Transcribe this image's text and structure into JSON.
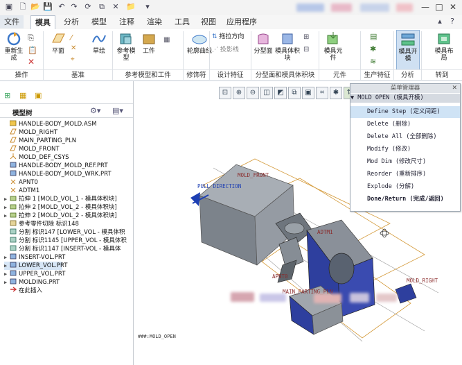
{
  "tabs": [
    {
      "label": "文件",
      "active": false
    },
    {
      "label": "模具",
      "active": true
    },
    {
      "label": "分析",
      "active": false
    },
    {
      "label": "模型",
      "active": false
    },
    {
      "label": "注释",
      "active": false
    },
    {
      "label": "渲染",
      "active": false
    },
    {
      "label": "工具",
      "active": false
    },
    {
      "label": "视图",
      "active": false
    },
    {
      "label": "应用程序",
      "active": false
    }
  ],
  "ribbon": {
    "regenerate": "重新生成",
    "plane": "平面",
    "sketch": "草绘",
    "ref_model": "参考模型",
    "workpiece": "工件",
    "contour_curve": "轮廓曲线",
    "drag_direction": "拖拉方向",
    "shadow_line": "投影线",
    "split_surface": "分型面",
    "mold_volume": "模具体积块",
    "mold_component": "模具元件",
    "mold_open": "模具开模",
    "mold_layout": "模具布局",
    "groups": [
      "操作",
      "基准",
      "参考模型和工件",
      "修饰符",
      "设计特征",
      "分型面和模具体积块",
      "元件",
      "生产特征",
      "分析",
      "转到"
    ]
  },
  "tree": {
    "tab_title": "模型树",
    "items": [
      {
        "label": "HANDLE-BODY_MOLD.ASM",
        "type": "asm",
        "expand": ""
      },
      {
        "label": "MOLD_RIGHT",
        "type": "plane",
        "expand": ""
      },
      {
        "label": "MAIN_PARTING_PLN",
        "type": "plane",
        "expand": ""
      },
      {
        "label": "MOLD_FRONT",
        "type": "plane",
        "expand": ""
      },
      {
        "label": "MOLD_DEF_CSYS",
        "type": "csys",
        "expand": ""
      },
      {
        "label": "HANDLE-BODY_MOLD_REF.PRT",
        "type": "part",
        "expand": ""
      },
      {
        "label": "HANDLE-BODY_MOLD_WRK.PRT",
        "type": "part",
        "expand": ""
      },
      {
        "label": "APNT0",
        "type": "point",
        "expand": ""
      },
      {
        "label": "ADTM1",
        "type": "point",
        "expand": ""
      },
      {
        "label": "拉伸 1 [MOLD_VOL_1 - 模具体积块]",
        "type": "extrude",
        "expand": "▶"
      },
      {
        "label": "拉伸 2 [MOLD_VOL_2 - 模具体积块]",
        "type": "extrude",
        "expand": "▶"
      },
      {
        "label": "拉伸 2 [MOLD_VOL_2 - 模具体积块]",
        "type": "extrude",
        "expand": "▶"
      },
      {
        "label": "参考零件切除 标识148",
        "type": "cut",
        "expand": ""
      },
      {
        "label": "分割 标识147 [LOWER_VOL - 模具体积",
        "type": "split",
        "expand": ""
      },
      {
        "label": "分割 标识1145 [UPPER_VOL - 模具体积",
        "type": "split",
        "expand": ""
      },
      {
        "label": "分割 标识1147 [INSERT-VOL - 模具体",
        "type": "split",
        "expand": ""
      },
      {
        "label": "INSERT-VOL.PRT",
        "type": "part",
        "expand": "▶"
      },
      {
        "label": "LOWER_VOL.PRT",
        "type": "part",
        "expand": "▶",
        "selected": true
      },
      {
        "label": "UPPER_VOL.PRT",
        "type": "part",
        "expand": "▶"
      },
      {
        "label": "MOLDING.PRT",
        "type": "part",
        "expand": "▶"
      },
      {
        "label": "在此插入",
        "type": "insert",
        "expand": ""
      }
    ]
  },
  "menu": {
    "title": "菜单管理器",
    "subtitle": "▼ MOLD OPEN (模具开模)",
    "items": [
      {
        "label": "Define Step (定义间距)",
        "selected": true
      },
      {
        "label": "Delete (删除)"
      },
      {
        "label": "Delete All (全部删除)"
      },
      {
        "label": "Modify (修改)"
      },
      {
        "label": "Mod Dim (修改尺寸)"
      },
      {
        "label": "Reorder (重新排序)"
      },
      {
        "label": "Explode (分解)"
      },
      {
        "label": "Done/Return (完成/返回)",
        "bold": true
      }
    ]
  },
  "viewport": {
    "labels": {
      "pull_direction": "PULL DIRECTION",
      "mold_front": "MOLD_FRONT",
      "adtm1": "ADTM1",
      "apnt0": "APNT0",
      "main_parting_pln": "MAIN_PARTING_PLN",
      "mold_right": "MOLD_RIGHT"
    },
    "status": "###:MOLD_OPEN"
  },
  "colors": {
    "accent": "#3b77c9",
    "block_grey": "#8f959c",
    "block_blue": "#2e3f9e",
    "datum_orange": "#c98a2b",
    "datum_label": "#8a2a2a"
  }
}
